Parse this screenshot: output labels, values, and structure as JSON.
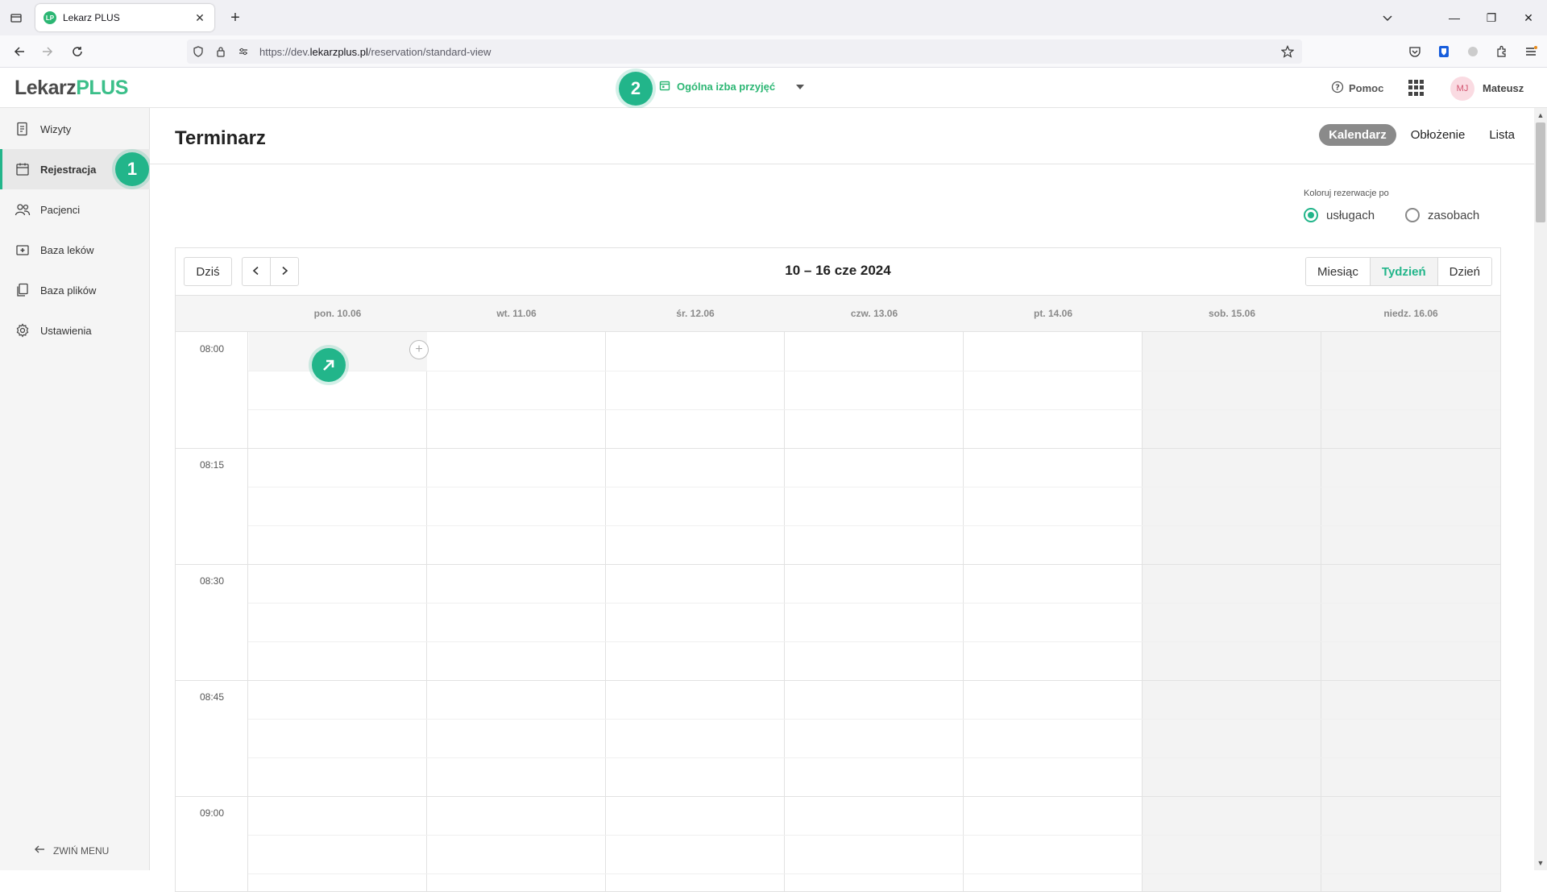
{
  "browser": {
    "tab_title": "Lekarz PLUS",
    "tab_favicon_text": "LP",
    "url_prefix": "https://dev.",
    "url_domain": "lekarzplus.pl",
    "url_path": "/reservation/standard-view"
  },
  "header": {
    "logo_part1": "Lekarz",
    "logo_part2": "PLUS",
    "room": "Ogólna izba przyjęć",
    "help": "Pomoc",
    "avatar_initials": "MJ",
    "user_name": "Mateusz",
    "step_badge": "2"
  },
  "sidebar": {
    "items": [
      {
        "label": "Wizyty",
        "icon": "document-list-icon"
      },
      {
        "label": "Rejestracja",
        "icon": "calendar-icon",
        "active": true
      },
      {
        "label": "Pacjenci",
        "icon": "people-icon"
      },
      {
        "label": "Baza leków",
        "icon": "medkit-icon"
      },
      {
        "label": "Baza plików",
        "icon": "files-icon"
      },
      {
        "label": "Ustawienia",
        "icon": "gear-icon"
      }
    ],
    "step_badge": "1",
    "collapse_label": "ZWIŃ MENU"
  },
  "page": {
    "title": "Terminarz",
    "view_tabs": [
      "Kalendarz",
      "Obłożenie",
      "Lista"
    ],
    "active_view": "Kalendarz"
  },
  "color_by": {
    "label": "Koloruj rezerwacje po",
    "options": [
      "usługach",
      "zasobach"
    ],
    "selected": "usługach"
  },
  "calendar": {
    "today_label": "Dziś",
    "range_title": "10 – 16 cze 2024",
    "modes": [
      "Miesiąc",
      "Tydzień",
      "Dzień"
    ],
    "active_mode": "Tydzień",
    "days": [
      "pon. 10.06",
      "wt. 11.06",
      "śr. 12.06",
      "czw. 13.06",
      "pt. 14.06",
      "sob. 15.06",
      "niedz. 16.06"
    ],
    "times": [
      "08:00",
      "08:15",
      "08:30",
      "08:45",
      "09:00"
    ],
    "accent_color": "#22b58a"
  }
}
